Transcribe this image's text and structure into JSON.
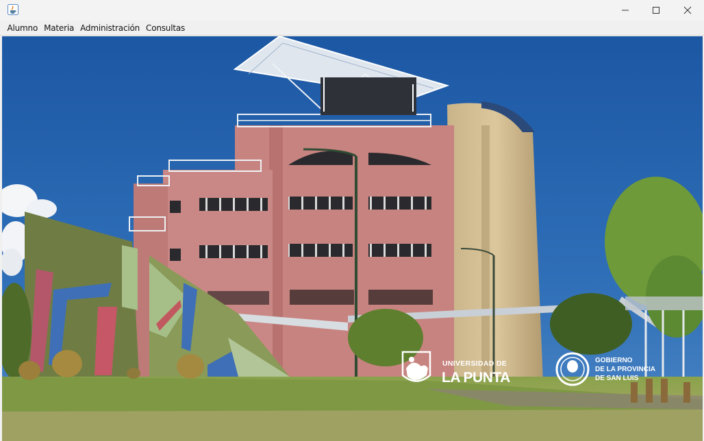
{
  "window": {
    "icon": "java-cup-icon",
    "controls": [
      "minimize-icon",
      "maximize-icon",
      "close-icon"
    ]
  },
  "menubar": {
    "items": [
      {
        "label": "Alumno"
      },
      {
        "label": "Materia"
      },
      {
        "label": "Administración"
      },
      {
        "label": "Consultas"
      }
    ]
  },
  "logos": {
    "ulp_line1": "UNIVERSIDAD DE",
    "ulp_line2": "LA PUNTA",
    "gov_line1": "GOBIERNO",
    "gov_line2": "DE LA PROVINCIA",
    "gov_line3": "DE SAN LUIS"
  },
  "colors": {
    "sky": "#1d5aa6",
    "building": "#c9827f",
    "grass": "#7f9a43"
  }
}
